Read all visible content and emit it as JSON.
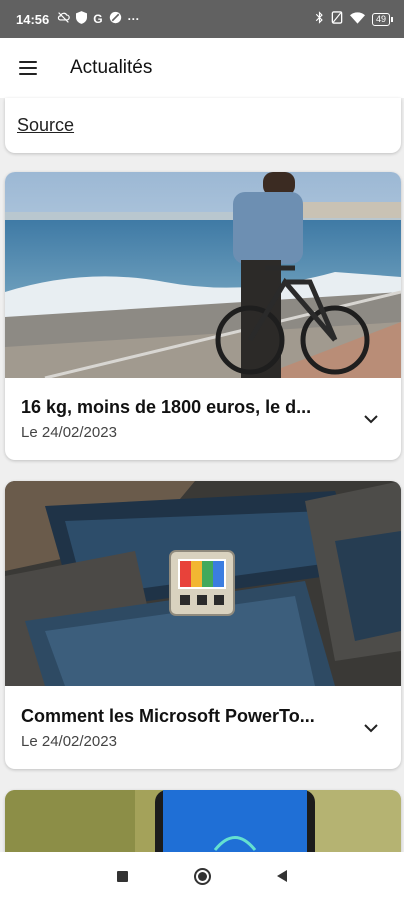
{
  "status": {
    "time": "14:56",
    "left_icons": [
      "cloud-off-icon",
      "shield-icon",
      "g-icon",
      "moon-icon",
      "more-icon"
    ],
    "g_label": "G",
    "more_label": "···",
    "battery": "49"
  },
  "appbar": {
    "title": "Actualités"
  },
  "previous_card": {
    "source_label": "Source"
  },
  "articles": [
    {
      "title": "16 kg, moins de 1800 euros, le d...",
      "date": "Le 24/02/2023",
      "image": "bike-on-promenade"
    },
    {
      "title": "Comment les Microsoft PowerTo...",
      "date": "Le 24/02/2023",
      "image": "powertoys-windows"
    },
    {
      "title": "",
      "date": "",
      "image": "phone-green-background"
    }
  ],
  "colors": {
    "statusbar": "#616161",
    "card_bg": "#ffffff",
    "page_bg": "#efefef"
  }
}
